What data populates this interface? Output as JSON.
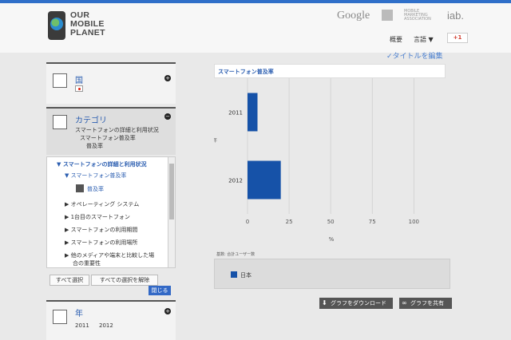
{
  "header": {
    "logo_line1": "OUR",
    "logo_line2": "MOBILE",
    "logo_line3": "PLANET",
    "brand_google": "Google",
    "brand_iab": "iab.",
    "brand_mma": "MOBILE MARKETING ASSOCIATION",
    "nav_overview": "概要",
    "nav_language": "言語 ▼",
    "nav_gplus": "+1"
  },
  "sidebar": {
    "country": {
      "title": "国",
      "toggle": "+"
    },
    "category": {
      "title": "カテゴリ",
      "toggle": "−",
      "lines": [
        "スマートフォンの詳細と利用状況",
        "スマートフォン普及率",
        "普及率"
      ]
    },
    "tree": {
      "items": [
        "▼ スマートフォンの詳細と利用状況",
        "▼ スマートフォン普及率",
        "普及率",
        "▶ オペレーティング システム",
        "▶ 1台目のスマートフォン",
        "▶ スマートフォンの利用期間",
        "▶ スマートフォンの利用場所",
        "▶ 他のメディアや端末と比較した場",
        "合の重要性"
      ]
    },
    "buttons": {
      "select_all": "すべて選択",
      "clear_all": "すべての選択を解除",
      "close": "閉じる"
    },
    "year": {
      "title": "年",
      "toggle": "+",
      "values": [
        "2011",
        "2012"
      ]
    }
  },
  "main": {
    "edit_title": "タイトルを編集",
    "notes": "基数: 合計ユーザー数",
    "download_label": "グラフをダウンロード",
    "share_label": "グラフを共有",
    "download_icon": "download-icon",
    "share_icon": "link-icon"
  },
  "colors": {
    "accent": "#2f6fc9",
    "bar": "#1652a8"
  },
  "chart_data": {
    "type": "bar",
    "orientation": "horizontal",
    "title": "スマートフォン普及率",
    "categories": [
      "2011",
      "2012"
    ],
    "series": [
      {
        "name": "日本",
        "values": [
          6,
          20
        ]
      }
    ],
    "xlabel": "%",
    "ylabel": "年",
    "xticks": [
      0,
      25,
      50,
      75,
      100
    ],
    "xlim": [
      0,
      120
    ],
    "grid": true,
    "legend": "bottom"
  }
}
